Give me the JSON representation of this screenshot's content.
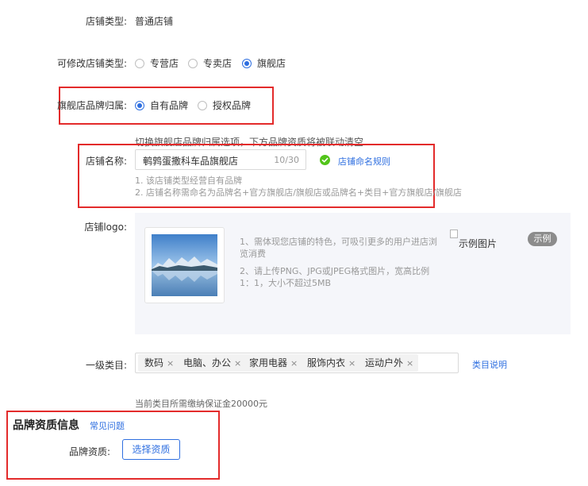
{
  "store_type": {
    "label": "店铺类型:",
    "value": "普通店铺"
  },
  "modify_type": {
    "label": "可修改店铺类型:",
    "options": [
      {
        "label": "专营店",
        "checked": false
      },
      {
        "label": "专卖店",
        "checked": false
      },
      {
        "label": "旗舰店",
        "checked": true
      }
    ]
  },
  "brand_belong": {
    "label": "旗舰店品牌归属:",
    "options": [
      {
        "label": "自有品牌",
        "checked": true
      },
      {
        "label": "授权品牌",
        "checked": false
      }
    ],
    "notice": "切换旗舰店品牌归属选项，下方品牌资质将被联动清空"
  },
  "store_name": {
    "label": "店铺名称:",
    "value": "鹌鹑蛋撒科车品旗舰店",
    "counter": "10/30",
    "rule_link": "店铺命名规则",
    "hints": [
      "1. 该店铺类型经营自有品牌",
      "2. 店铺名称需命名为品牌名+官方旗舰店/旗舰店或品牌名+类目+官方旗舰店/旗舰店"
    ]
  },
  "store_logo": {
    "label": "店铺logo:",
    "desc": [
      "1、需体现您店铺的特色，可吸引更多的用户进店浏",
      "览消费",
      "2、请上传PNG、JPG或JPEG格式图片，宽高比例",
      "1：1，大小不超过5MB"
    ],
    "example_alt": "示例图片",
    "example_button": "示例"
  },
  "category": {
    "label": "一级类目:",
    "tags": [
      "数码",
      "电脑、办公",
      "家用电器",
      "服饰内衣",
      "运动户外"
    ],
    "remove_glyph": "×",
    "link": "类目说明",
    "deposit_note": "当前类目所需缴纳保证金20000元"
  },
  "brand_section": {
    "title": "品牌资质信息",
    "faq_link": "常见问题",
    "qual_label": "品牌资质:",
    "select_button": "选择资质"
  },
  "colors": {
    "accent": "#2f6fe0",
    "highlight": "#e32b2b",
    "success": "#52c41a"
  }
}
